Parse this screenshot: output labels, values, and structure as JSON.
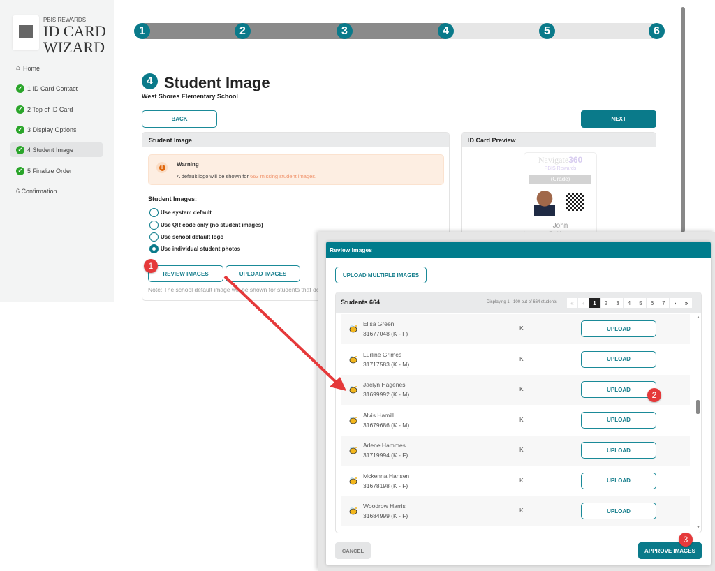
{
  "sidebar": {
    "logo_small": "PBIS REWARDS",
    "logo_line1": "ID CARD",
    "logo_line2": "WIZARD",
    "items": [
      {
        "label": "Home",
        "icon": "home-icon"
      },
      {
        "label": "1 ID Card Contact",
        "done": true
      },
      {
        "label": "2 Top of ID Card",
        "done": true
      },
      {
        "label": "3 Display Options",
        "done": true
      },
      {
        "label": "4 Student Image",
        "done": true,
        "active": true
      },
      {
        "label": "5 Finalize Order",
        "done": true
      },
      {
        "label": "6 Confirmation",
        "done": false
      }
    ]
  },
  "progress": {
    "steps": [
      "1",
      "2",
      "3",
      "4",
      "5",
      "6"
    ],
    "current": 4
  },
  "header": {
    "step": "4",
    "title": "Student Image",
    "school": "West Shores Elementary School"
  },
  "buttons": {
    "back": "BACK",
    "next": "NEXT",
    "review": "REVIEW IMAGES",
    "upload": "UPLOAD IMAGES"
  },
  "student_panel": {
    "title": "Student Image",
    "warning_title": "Warning",
    "warning_text": "A default logo will be shown for ",
    "warning_link": "663 missing student images.",
    "options_label": "Student Images:",
    "options": [
      "Use system default",
      "Use QR code only (no student images)",
      "Use school default logo",
      "Use individual student photos"
    ],
    "selected": 3,
    "note": "Note: The school default image will be shown for students that do"
  },
  "preview": {
    "title": "ID Card Preview",
    "brand": "Navigate",
    "brand_num": "360",
    "sub": "PBIS Rewards",
    "grade": "(Grade)",
    "first": "John",
    "last": "Smithson"
  },
  "modal": {
    "title": "Review Images",
    "upload_multiple": "UPLOAD MULTIPLE IMAGES",
    "students_label": "Students 664",
    "displaying": "Displaying 1 - 100 out of 664 students",
    "pages": [
      "1",
      "2",
      "3",
      "4",
      "5",
      "6",
      "7"
    ],
    "current_page": "1",
    "students": [
      {
        "name": "Elisa Green",
        "id": "31677048 (K - F)",
        "grade": "K",
        "action": "UPLOAD"
      },
      {
        "name": "Lurline Grimes",
        "id": "31717583 (K - M)",
        "grade": "K",
        "action": "UPLOAD"
      },
      {
        "name": "Jaclyn Hagenes",
        "id": "31699992 (K - M)",
        "grade": "K",
        "action": "UPLOAD"
      },
      {
        "name": "Alvis Hamill",
        "id": "31679686 (K - M)",
        "grade": "K",
        "action": "UPLOAD"
      },
      {
        "name": "Arlene Hammes",
        "id": "31719994 (K - F)",
        "grade": "K",
        "action": "UPLOAD"
      },
      {
        "name": "Mckenna Hansen",
        "id": "31678198 (K - F)",
        "grade": "K",
        "action": "UPLOAD"
      },
      {
        "name": "Woodrow Harris",
        "id": "31684999 (K - F)",
        "grade": "K",
        "action": "UPLOAD"
      }
    ],
    "cancel": "CANCEL",
    "approve": "APPROVE IMAGES"
  },
  "callouts": [
    "1",
    "2",
    "3"
  ],
  "colors": {
    "teal": "#0a7a8a",
    "callout": "#e5393a",
    "warning_bg": "#fdeee2",
    "warning_link": "#f0926a"
  }
}
